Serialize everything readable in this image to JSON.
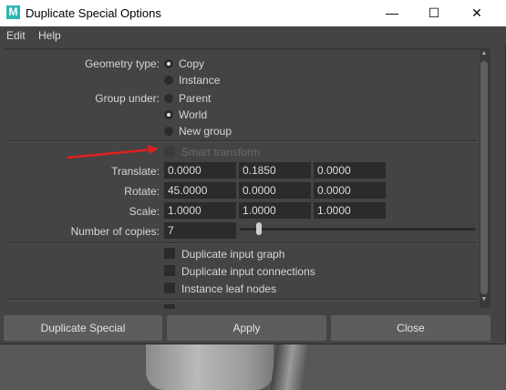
{
  "window": {
    "title": "Duplicate Special Options",
    "app_icon_letter": "M"
  },
  "menu": {
    "items": [
      "Edit",
      "Help"
    ]
  },
  "geometry_type": {
    "label": "Geometry type:",
    "options": [
      "Copy",
      "Instance"
    ],
    "selected": "Copy"
  },
  "group_under": {
    "label": "Group under:",
    "options": [
      "Parent",
      "World",
      "New group"
    ],
    "selected": "Parent"
  },
  "smart_transform": {
    "label": "Smart transform",
    "checked": false,
    "enabled": false
  },
  "translate": {
    "label": "Translate:",
    "values": [
      "0.0000",
      "0.1850",
      "0.0000"
    ]
  },
  "rotate": {
    "label": "Rotate:",
    "values": [
      "45.0000",
      "0.0000",
      "0.0000"
    ]
  },
  "scale": {
    "label": "Scale:",
    "values": [
      "1.0000",
      "1.0000",
      "1.0000"
    ]
  },
  "copies": {
    "label": "Number of copies:",
    "value": "7"
  },
  "options": [
    {
      "label": "Duplicate input graph",
      "checked": false
    },
    {
      "label": "Duplicate input connections",
      "checked": false
    },
    {
      "label": "Instance leaf nodes",
      "checked": false
    }
  ],
  "buttons": {
    "duplicate": "Duplicate Special",
    "apply": "Apply",
    "close": "Close"
  },
  "colors": {
    "annotation_arrow": "#e02020",
    "app_icon": "#2fb6b4"
  }
}
